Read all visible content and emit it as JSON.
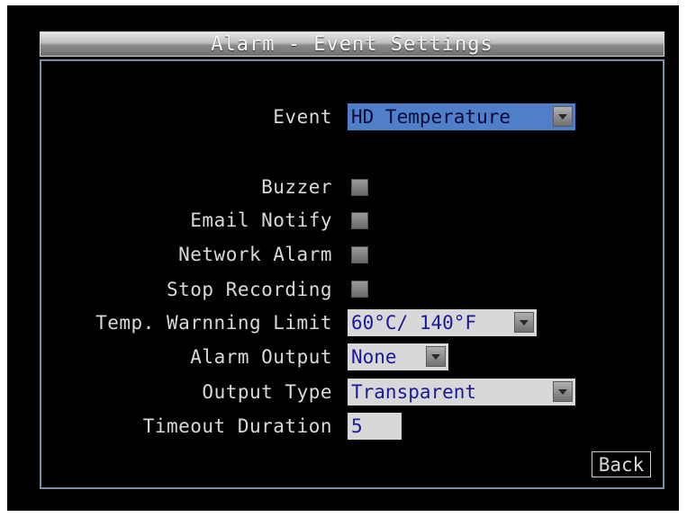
{
  "window": {
    "title": "Alarm - Event Settings"
  },
  "settings": {
    "event": {
      "label": "Event",
      "value": "HD Temperature"
    },
    "buzzer": {
      "label": "Buzzer",
      "checked": false
    },
    "email_notify": {
      "label": "Email Notify",
      "checked": false
    },
    "network_alarm": {
      "label": "Network Alarm",
      "checked": false
    },
    "stop_recording": {
      "label": "Stop Recording",
      "checked": false
    },
    "temp_limit": {
      "label": "Temp. Warnning Limit",
      "value": "60°C/ 140°F"
    },
    "alarm_output": {
      "label": "Alarm Output",
      "value": "None"
    },
    "output_type": {
      "label": "Output Type",
      "value": "Transparent"
    },
    "timeout_duration": {
      "label": "Timeout Duration",
      "value": "5"
    }
  },
  "footer": {
    "back_label": "Back"
  },
  "colors": {
    "background": "#000000",
    "label_text": "#d9d9d9",
    "selected_field": "#4f7fc8",
    "field_background": "#d8d8d8",
    "panel_border": "#7f8fa8"
  }
}
